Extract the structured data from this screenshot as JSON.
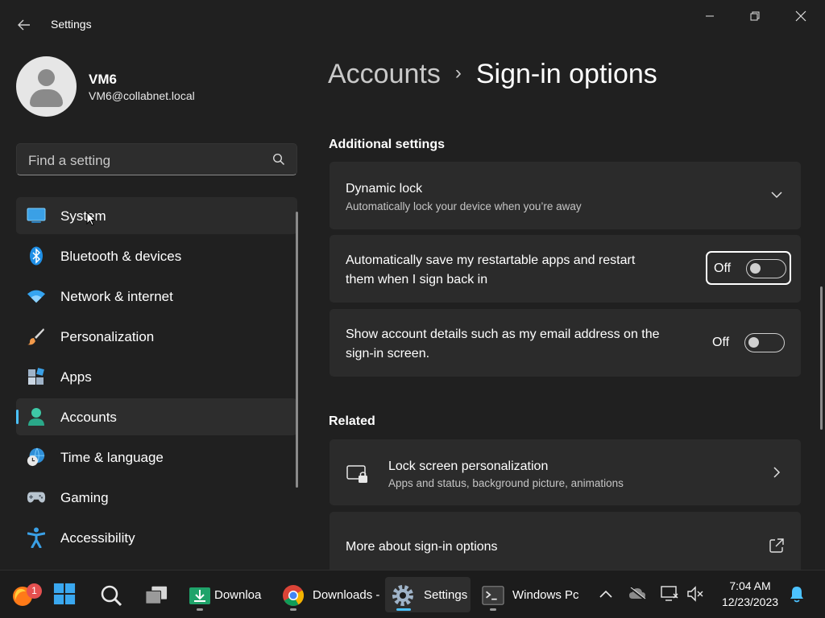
{
  "titlebar": {
    "app_title": "Settings"
  },
  "profile": {
    "name": "VM6",
    "email": "VM6@collabnet.local"
  },
  "search": {
    "placeholder": "Find a setting"
  },
  "nav": {
    "items": [
      {
        "label": "System",
        "icon": "system-icon"
      },
      {
        "label": "Bluetooth & devices",
        "icon": "bluetooth-icon"
      },
      {
        "label": "Network & internet",
        "icon": "wifi-icon"
      },
      {
        "label": "Personalization",
        "icon": "brush-icon"
      },
      {
        "label": "Apps",
        "icon": "apps-icon"
      },
      {
        "label": "Accounts",
        "icon": "accounts-icon",
        "selected": true
      },
      {
        "label": "Time & language",
        "icon": "globe-clock-icon"
      },
      {
        "label": "Gaming",
        "icon": "gamepad-icon"
      },
      {
        "label": "Accessibility",
        "icon": "accessibility-icon"
      }
    ]
  },
  "breadcrumb": {
    "parent": "Accounts",
    "separator": "›",
    "current": "Sign-in options"
  },
  "additional": {
    "title": "Additional settings",
    "dynamic_lock": {
      "title": "Dynamic lock",
      "subtitle": "Automatically lock your device when you’re away"
    },
    "restart_apps": {
      "line1": "Automatically save my restartable apps and restart",
      "line2": "them when I sign back in",
      "state": "Off",
      "on": false
    },
    "account_details": {
      "line1": "Show account details such as my email address on the",
      "line2": "sign-in screen.",
      "state": "Off",
      "on": false
    }
  },
  "related": {
    "title": "Related",
    "lock_screen": {
      "title": "Lock screen personalization",
      "subtitle": "Apps and status, background picture, animations"
    },
    "more": {
      "title": "More about sign-in options"
    }
  },
  "taskbar": {
    "firefox_badge": "1",
    "apps": [
      {
        "label": "Downloa",
        "icon": "download-icon"
      },
      {
        "label": "Downloads -",
        "icon": "chrome-icon"
      },
      {
        "label": "Settings",
        "icon": "settings-gear-icon"
      },
      {
        "label": "Windows Pc",
        "icon": "terminal-icon"
      }
    ],
    "time": "7:04 AM",
    "date": "12/23/2023"
  },
  "colors": {
    "accent": "#4cc2ff",
    "background": "#202020",
    "card": "#2b2b2b"
  }
}
